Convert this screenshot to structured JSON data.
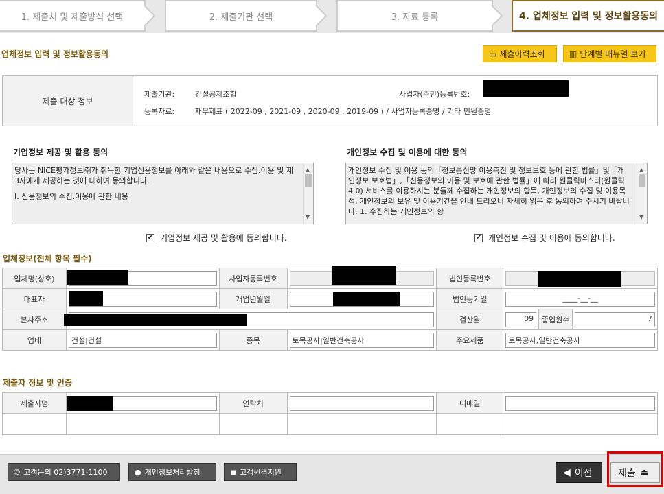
{
  "steps": [
    {
      "label": "1. 제출처 및 제출방식 선택"
    },
    {
      "label": "2. 제출기관 선택"
    },
    {
      "label": "3. 자료 등록"
    },
    {
      "label": "4. 업체정보 입력 및 정보활용동의"
    }
  ],
  "page_title": "업체정보 입력 및 정보활용동의",
  "buttons": {
    "history": "제출이력조회",
    "manual": "단계별 매뉴얼 보기"
  },
  "target": {
    "header": "제출 대상 정보",
    "agency_label": "제출기관:",
    "agency_value": "건설공제조합",
    "bizno_label": "사업자(주민)등록번호:",
    "docs_label": "등록자료:",
    "docs_value": "재무제표 ( 2022-09 , 2021-09 , 2020-09 , 2019-09 ) / 사업자등록증명 / 기타 민원증명"
  },
  "consent": {
    "corp_title": "기업정보 제공 및 활용 동의",
    "corp_text": "당사는 NICE평가정보㈜가 취득한 기업신용정보를 아래와 같은 내용으로 수집.이용 및 제3자에게 제공하는 것에 대하여 동의합니다.",
    "corp_text2": "Ⅰ. 신용정보의 수집.이용에 관한 내용",
    "corp_check": "기업정보 제공 및 활용에 동의합니다.",
    "personal_title": "개인정보 수집 및 이용에 대한 동의",
    "personal_text": "개인정보 수집 및 이용 동의「정보통신망 이용촉진 및 정보보호 등에 관한 법률」및「개인정보 보호법」,「신용정보의 이용 및 보호에 관한 법률」에 따라 원클릭마스터(원클릭4.0) 서비스를 이용하시는 분들께 수집하는 개인정보의 항목, 개인정보의 수집 및 이용목적, 개인정보의 보유 및 이용기간을 안내 드리오니 자세히 읽은 후 동의하여 주시기 바랍니다. 1. 수집하는 개인정보의 항",
    "personal_check": "개인정보 수집 및 이용에 동의합니다."
  },
  "company": {
    "section_title": "업체정보(전체 항목 필수)",
    "labels": {
      "name": "업체명(상호)",
      "bizno": "사업자등록번호",
      "corpno": "법인등록번호",
      "ceo": "대표자",
      "founded": "개업년월일",
      "corp_date": "법인등기일",
      "address": "본사주소",
      "fiscal": "결산월",
      "employees": "종업원수",
      "biztype": "업태",
      "item": "종목",
      "product": "주요제품"
    },
    "values": {
      "corp_date": "____-__-__",
      "fiscal": "09",
      "employees": "7",
      "biztype": "건설|건설",
      "item": "토목공사|일반건축공사",
      "product": "토목공사,일반건축공사"
    }
  },
  "submitter": {
    "section_title": "제출자 정보 및 인증",
    "name_label": "제출자명",
    "contact_label": "연락처",
    "email_label": "이메일"
  },
  "footer": {
    "cs": "고객문의  02)3771-1100",
    "privacy": "개인정보처리방침",
    "remote": "고객원격지원",
    "prev": "이전",
    "submit": "제출"
  }
}
